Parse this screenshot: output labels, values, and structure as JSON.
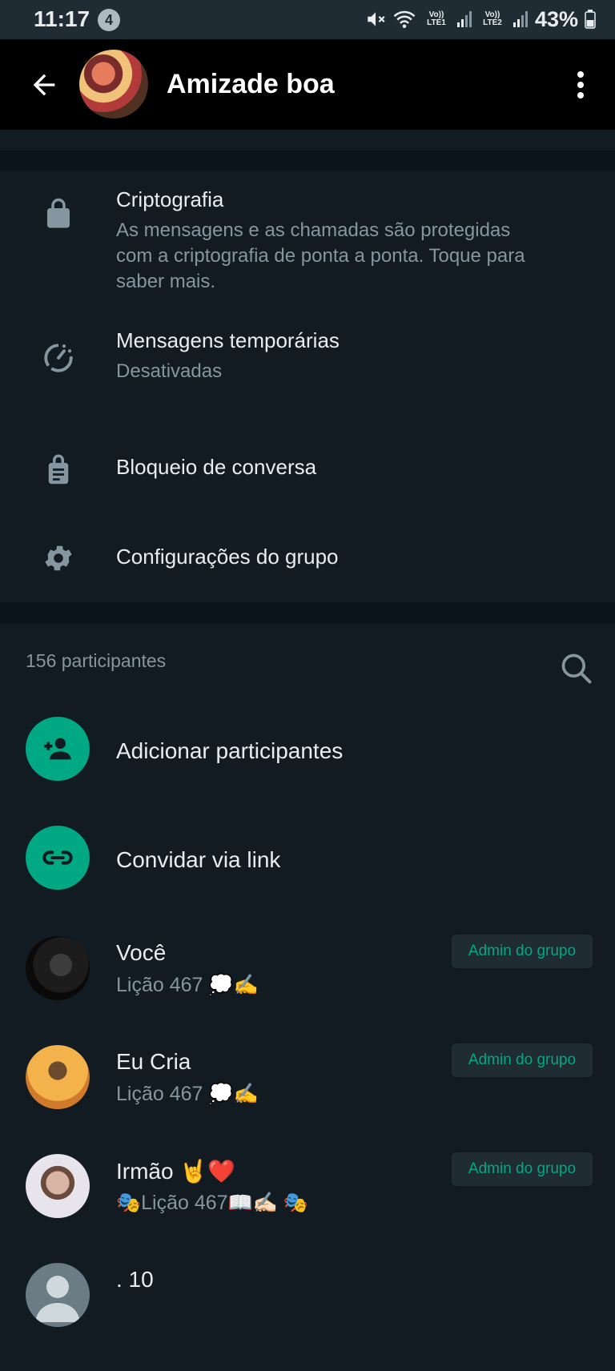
{
  "status_bar": {
    "time": "11:17",
    "notification_count": "4",
    "sim1_label": "Vo)) LTE1",
    "sim2_label": "Vo)) LTE2",
    "battery": "43%",
    "icons": [
      "mute-icon",
      "wifi-icon",
      "signal-icon",
      "battery-icon"
    ]
  },
  "header": {
    "title": "Amizade boa",
    "icons": [
      "back-arrow-icon",
      "group-avatar",
      "more-vert-icon"
    ]
  },
  "settings": {
    "encryption_title": "Criptografia",
    "encryption_desc": "As mensagens e as chamadas são protegidas com a criptografia de ponta a ponta. Toque para saber mais.",
    "disappearing_title": "Mensagens temporárias",
    "disappearing_value": "Desativadas",
    "chat_lock_title": "Bloqueio de conversa",
    "group_settings_title": "Configurações do grupo"
  },
  "participants": {
    "count_label": "156 participantes",
    "add_label": "Adicionar participantes",
    "invite_label": "Convidar via link",
    "members": [
      {
        "name": "Você",
        "status": "Lição 467 💭✍️",
        "badge": "Admin do grupo"
      },
      {
        "name": "Eu Cria",
        "status": "Lição 467 💭✍️",
        "badge": "Admin do grupo"
      },
      {
        "name": "Irmão 🤘❤️",
        "status": "🎭Lição 467📖✍🏻 🎭",
        "badge": "Admin do grupo"
      },
      {
        "name": ". 10",
        "status": "",
        "badge": ""
      }
    ]
  },
  "colors": {
    "background": "#111b21",
    "accent_green": "#00a884",
    "secondary_text": "#8696a0",
    "header_bg": "#000000"
  }
}
